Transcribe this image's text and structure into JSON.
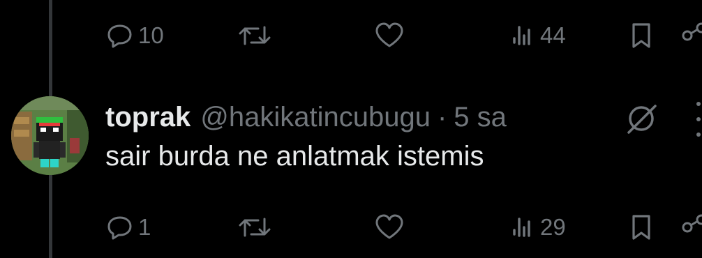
{
  "previous_tweet": {
    "reply_count": "10",
    "view_count": "44"
  },
  "tweet": {
    "display_name": "toprak",
    "handle": "@hakikatincubugu",
    "separator": "·",
    "time": "5 sa",
    "text": "sair burda ne anlatmak istemis",
    "reply_count": "1",
    "view_count": "29"
  },
  "icons": {
    "reply": "speech-bubble-icon",
    "retweet": "retweet-arrows-icon",
    "like": "heart-icon",
    "views": "bar-chart-icon",
    "bookmark": "bookmark-icon",
    "share": "share-icon",
    "grok": "grok-icon",
    "more": "more-vertical-icon"
  },
  "colors": {
    "background": "#000000",
    "text_primary": "#e7e9ea",
    "text_secondary": "#71767b",
    "thread_line": "#333639"
  }
}
